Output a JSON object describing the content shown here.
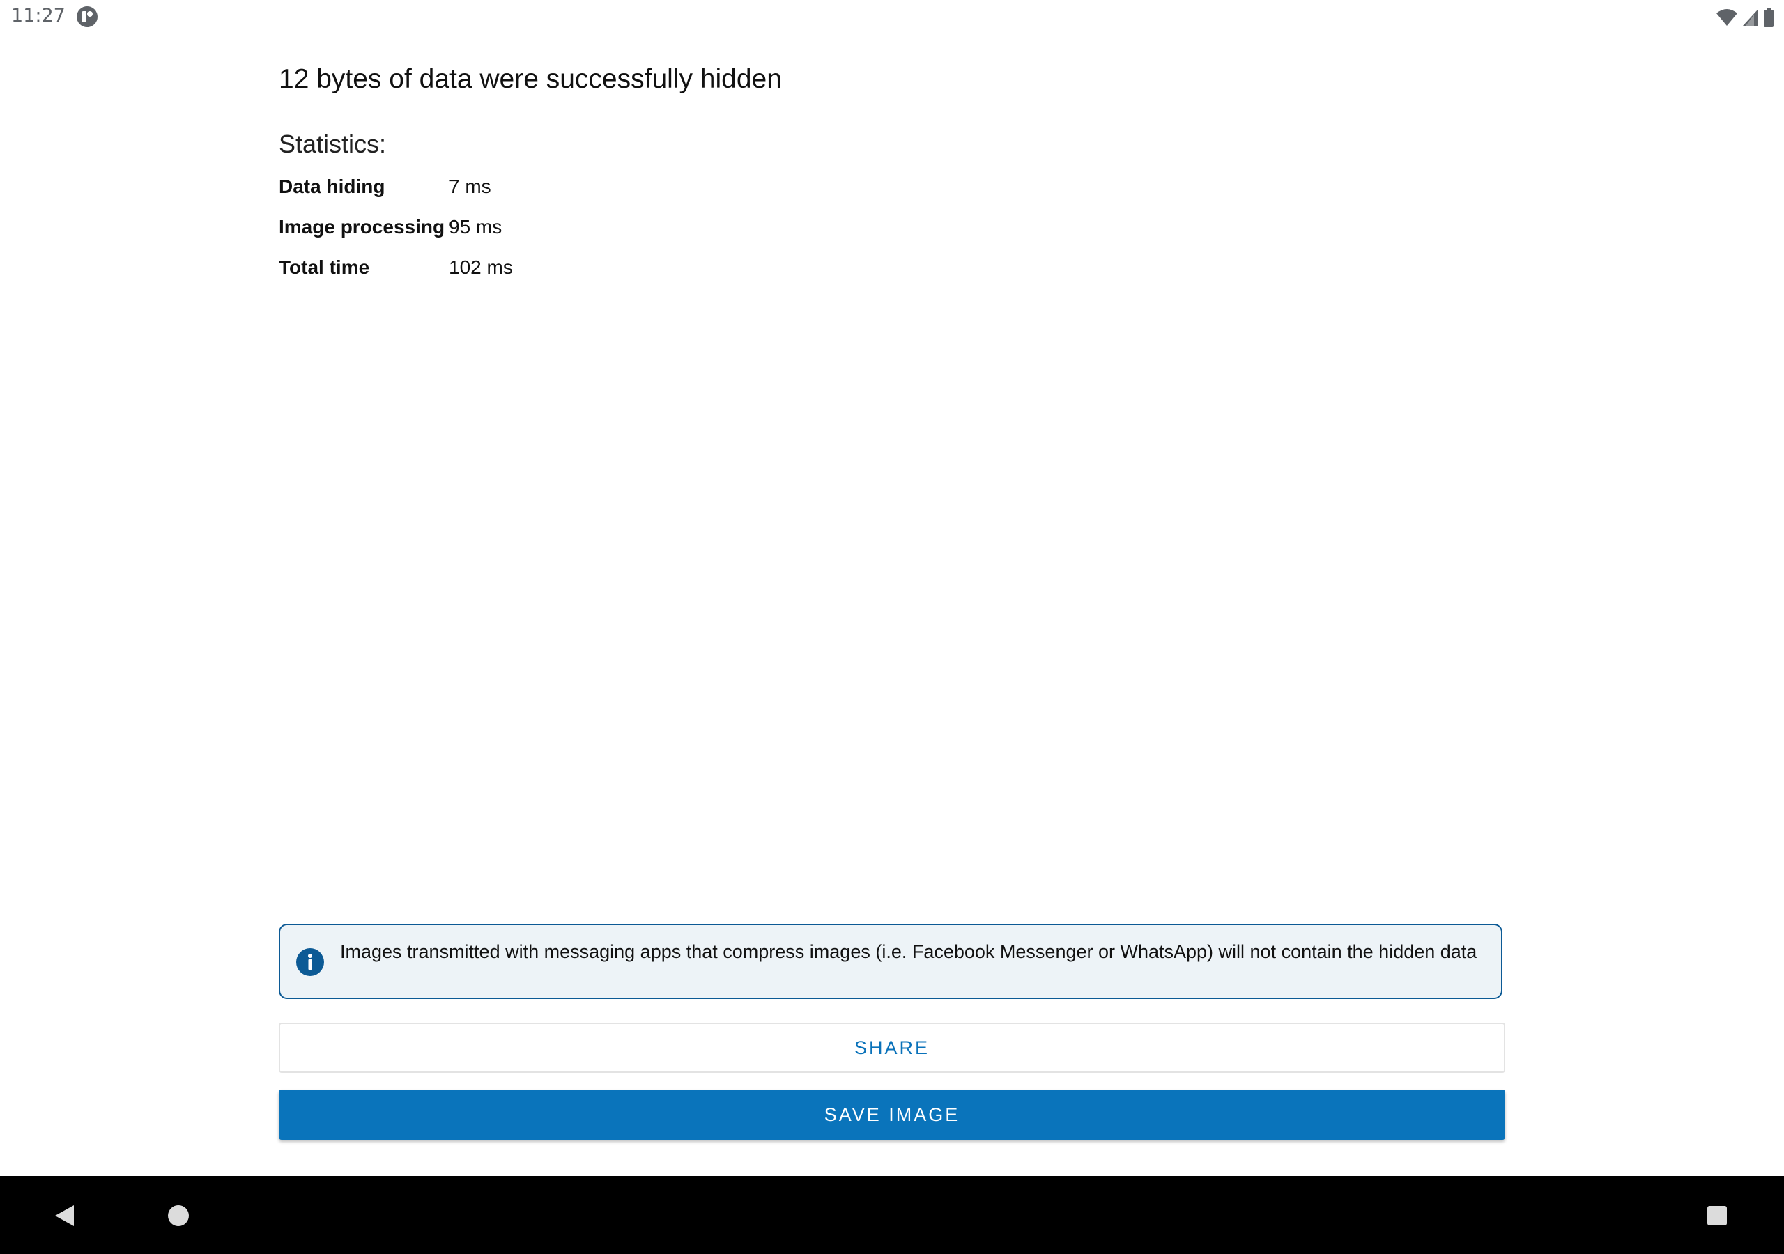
{
  "status_bar": {
    "time": "11:27",
    "app_icon": "notification-app-icon",
    "icons": [
      "wifi-icon",
      "cell-signal-icon",
      "battery-icon"
    ]
  },
  "result": {
    "headline": "12 bytes of data were successfully hidden"
  },
  "statistics": {
    "title": "Statistics:",
    "rows": [
      {
        "label": "Data hiding",
        "value": "7 ms"
      },
      {
        "label": "Image processing",
        "value": "95 ms"
      },
      {
        "label": "Total time",
        "value": "102 ms"
      }
    ]
  },
  "info": {
    "icon": "info-icon",
    "text": "Images transmitted with messaging apps that compress images (i.e. Facebook Messenger or WhatsApp) will not contain the hidden data"
  },
  "actions": {
    "share_label": "SHARE",
    "save_label": "SAVE IMAGE"
  },
  "colors": {
    "accent": "#0a74bb",
    "info_border": "#0c5a95",
    "info_background": "#edf3f7"
  },
  "nav_bar": {
    "icons": [
      "back-icon",
      "home-icon",
      "recents-icon"
    ]
  }
}
